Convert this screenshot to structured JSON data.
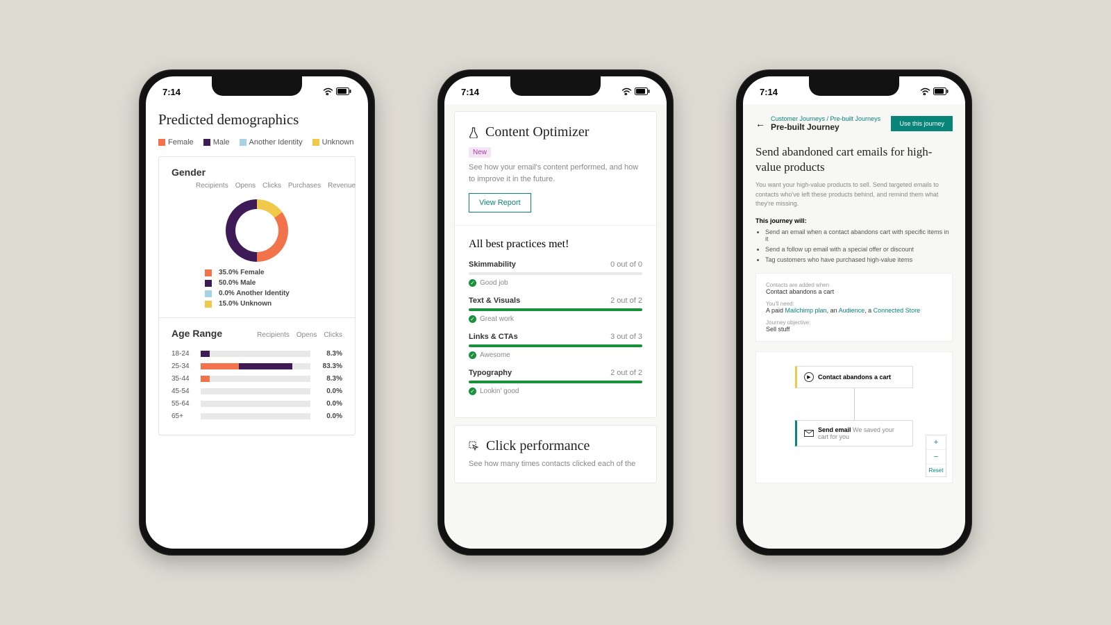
{
  "status": {
    "time": "7:14"
  },
  "phone1": {
    "title": "Predicted demographics",
    "legend": {
      "female": "Female",
      "male": "Male",
      "another": "Another Identity",
      "unknown": "Unknown"
    },
    "gender": {
      "title": "Gender",
      "tabs": [
        "Recipients",
        "Opens",
        "Clicks",
        "Purchases",
        "Revenue"
      ],
      "breakdown": {
        "female": "35.0% Female",
        "male": "50.0% Male",
        "another": "0.0% Another Identity",
        "unknown": "15.0% Unknown"
      }
    },
    "age": {
      "title": "Age Range",
      "tabs": [
        "Recipients",
        "Opens",
        "Clicks"
      ],
      "rows": [
        {
          "label": "18-24",
          "pct": "8.3%"
        },
        {
          "label": "25-34",
          "pct": "83.3%"
        },
        {
          "label": "35-44",
          "pct": "8.3%"
        },
        {
          "label": "45-54",
          "pct": "0.0%"
        },
        {
          "label": "55-64",
          "pct": "0.0%"
        },
        {
          "label": "65+",
          "pct": "0.0%"
        }
      ]
    }
  },
  "phone2": {
    "co": {
      "title": "Content Optimizer",
      "badge": "New",
      "sub": "See how your email's content performed, and how to improve it in the future.",
      "button": "View Report"
    },
    "practices": {
      "title": "All best practices met!",
      "items": [
        {
          "name": "Skimmability",
          "score": "0 out of 0",
          "note": "Good job",
          "fill": 0
        },
        {
          "name": "Text & Visuals",
          "score": "2 out of 2",
          "note": "Great work",
          "fill": 100
        },
        {
          "name": "Links & CTAs",
          "score": "3 out of 3",
          "note": "Awesome",
          "fill": 100
        },
        {
          "name": "Typography",
          "score": "2 out of 2",
          "note": "Lookin' good",
          "fill": 100
        }
      ]
    },
    "click": {
      "title": "Click performance",
      "sub": "See how many times contacts clicked each of the"
    }
  },
  "phone3": {
    "crumbs": {
      "path": "Customer Journeys / Pre-built Journeys",
      "title": "Pre-built Journey"
    },
    "cta": "Use this journey",
    "title": "Send abandoned cart emails for high-value products",
    "sub": "You want your high-value products to sell. Send targeted emails to contacts who've left these products behind, and remind them what they're missing.",
    "will_label": "This journey will:",
    "bullets": [
      "Send an email when a contact abandons cart with specific items in it",
      "Send a follow up email with a special offer or discount",
      "Tag customers who have purchased high-value items"
    ],
    "info": {
      "trigger_lbl": "Contacts are added when",
      "trigger_val": "Contact abandons a cart",
      "need_lbl": "You'll need:",
      "need_prefix": "A paid ",
      "need_link1": "Mailchimp plan",
      "need_mid1": ", an ",
      "need_link2": "Audience",
      "need_mid2": ", a ",
      "need_link3": "Connected Store",
      "obj_lbl": "Journey objective:",
      "obj_val": "Sell stuff"
    },
    "nodes": {
      "n1": "Contact abandons a cart",
      "n2_prefix": "Send email ",
      "n2_rest": "We saved your cart for you"
    },
    "zoom": {
      "plus": "+",
      "minus": "−",
      "reset": "Reset"
    }
  },
  "chart_data": [
    {
      "type": "pie",
      "title": "Gender",
      "series": [
        {
          "name": "Gender",
          "values": [
            35.0,
            50.0,
            0.0,
            15.0
          ]
        }
      ],
      "categories": [
        "Female",
        "Male",
        "Another Identity",
        "Unknown"
      ]
    },
    {
      "type": "bar",
      "title": "Age Range",
      "categories": [
        "18-24",
        "25-34",
        "35-44",
        "45-54",
        "55-64",
        "65+"
      ],
      "values": [
        8.3,
        83.3,
        8.3,
        0.0,
        0.0,
        0.0
      ],
      "xlabel": "",
      "ylabel": "",
      "ylim": [
        0,
        100
      ]
    }
  ]
}
